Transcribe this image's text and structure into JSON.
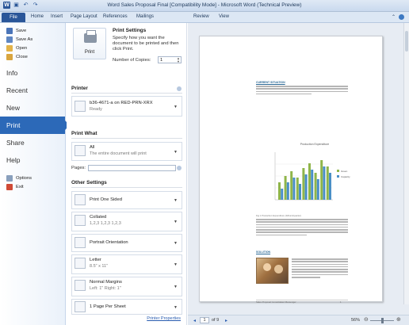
{
  "window": {
    "title": "Word Sales Proposal Final [Compatibility Mode] - Microsoft Word (Technical Preview)"
  },
  "ribbon": {
    "file_label": "File",
    "tabs": [
      "Home",
      "Insert",
      "Page Layout",
      "References",
      "Mailings",
      "Review",
      "View"
    ]
  },
  "nav": {
    "small_items": [
      {
        "label": "Save",
        "icon": "save-icon"
      },
      {
        "label": "Save As",
        "icon": "save-as-icon"
      },
      {
        "label": "Open",
        "icon": "open-folder-icon"
      },
      {
        "label": "Close",
        "icon": "close-folder-icon"
      }
    ],
    "big_items": [
      "Info",
      "Recent",
      "New",
      "Print",
      "Share",
      "Help"
    ],
    "active": "Print",
    "bottom_items": [
      {
        "label": "Options",
        "icon": "options-icon"
      },
      {
        "label": "Exit",
        "icon": "exit-icon"
      }
    ]
  },
  "print_panel": {
    "print_button": "Print",
    "settings_title": "Print Settings",
    "settings_desc": "Specify how you want the document to be printed and then click Print.",
    "copies_label": "Number of Copies:",
    "copies_value": "1",
    "printer_section": "Printer",
    "printer_name": "b36-4671-a on RED-PRN-XRX",
    "printer_status": "Ready",
    "print_what_section": "Print What",
    "print_what_value": "All",
    "print_what_desc": "The entire document will print",
    "pages_label": "Pages:",
    "other_settings_section": "Other Settings",
    "sided": "Print One Sided",
    "collated": "Collated",
    "collated_desc": "1,2,3   1,2,3   1,2,3",
    "orientation": "Portrait Orientation",
    "paper": "Letter",
    "paper_desc": "8.5\" x 11\"",
    "margins": "Normal Margins",
    "margins_desc": "Left: 1\"   Right: 1\"",
    "per_sheet": "1 Page Per Sheet",
    "printer_properties": "Printer Properties"
  },
  "preview": {
    "heading1": "CURRENT SITUATION",
    "chart_title": "Production Expenditure",
    "chart_caption": "Fig 1 Production Expenditure (bill/unit/quarter)",
    "heading2": "SOLUTION",
    "footer_text": "Sales Proposal Consolidated Messenger",
    "footer_page": "1",
    "page_current": "1",
    "page_of": "of 9",
    "zoom": "56%",
    "legend": [
      "Green",
      "Capacity"
    ]
  },
  "colors": {
    "accent": "#2c69b8",
    "file_tab": "#2a5699"
  }
}
